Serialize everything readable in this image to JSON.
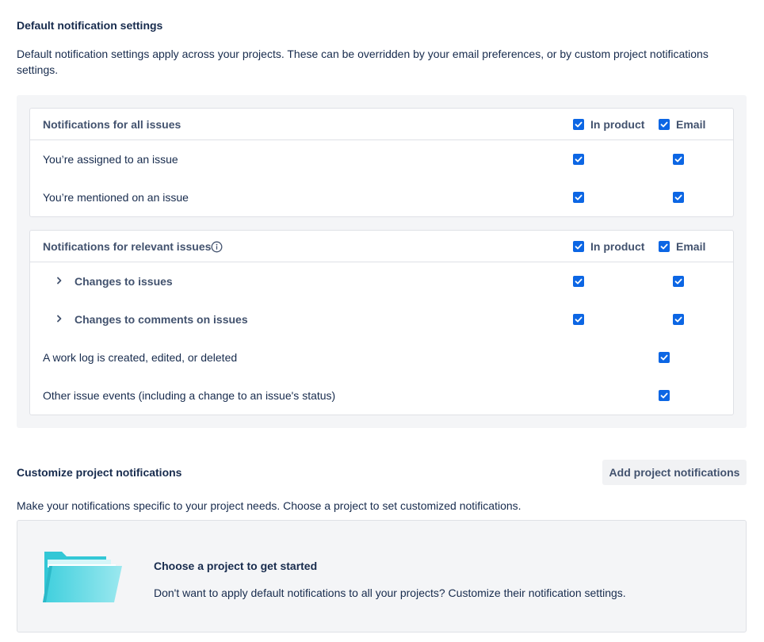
{
  "default_section": {
    "title": "Default notification settings",
    "description": "Default notification settings apply across your projects. These can be overridden by your email preferences, or by custom project notifications settings."
  },
  "all_issues": {
    "header": "Notifications for all issues",
    "col_in_product": "In product",
    "col_email": "Email",
    "rows": [
      {
        "label": "You’re assigned to an issue",
        "in_product": true,
        "email": true
      },
      {
        "label": "You’re mentioned on an issue",
        "in_product": true,
        "email": true
      }
    ]
  },
  "relevant_issues": {
    "header": "Notifications for relevant issues",
    "info_icon": "info-icon",
    "col_in_product": "In product",
    "col_email": "Email",
    "rows": [
      {
        "label": "Changes to issues",
        "expandable": true,
        "in_product": true,
        "email": true
      },
      {
        "label": "Changes to comments on issues",
        "expandable": true,
        "in_product": true,
        "email": true
      },
      {
        "label": "A work log is created, edited, or deleted",
        "expandable": false,
        "in_product": null,
        "email": true
      },
      {
        "label": "Other issue events (including a change to an issue's status)",
        "expandable": false,
        "in_product": null,
        "email": true
      }
    ]
  },
  "custom_section": {
    "title": "Customize project notifications",
    "add_button": "Add project notifications",
    "description": "Make your notifications specific to your project needs. Choose a project to set customized notifications.",
    "empty_title": "Choose a project to get started",
    "empty_description": "Don't want to apply default notifications to all your projects? Customize their notification settings.",
    "empty_icon": "folder-icon"
  },
  "colors": {
    "checkbox": "#0c66e4",
    "text": "#172b4d",
    "subtle_text": "#42526e",
    "panel_bg": "#f4f5f7",
    "border": "#dfe1e6"
  }
}
